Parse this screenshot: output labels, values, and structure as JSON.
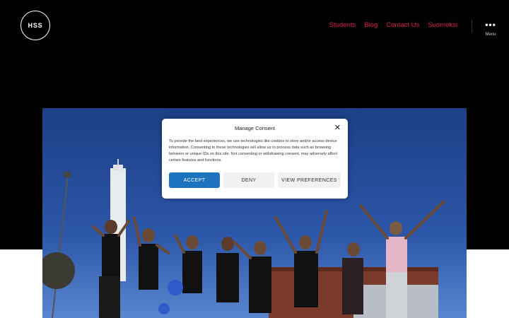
{
  "header": {
    "logo_text": "HSS",
    "nav": [
      "Students",
      "Blog",
      "Contact Us",
      "Suomeksi"
    ],
    "menu_label": "Menu",
    "menu_icon": "more-dots-icon"
  },
  "consent": {
    "title": "Manage Consent",
    "body": "To provide the best experiences, we use technologies like cookies to store and/or access device information. Consenting to these technologies will allow us to process data such as browsing behavior or unique IDs on this site. Not consenting or withdrawing consent, may adversely affect certain features and functions.",
    "accept_label": "ACCEPT",
    "deny_label": "DENY",
    "preferences_label": "VIEW PREFERENCES",
    "close_icon": "close-icon"
  },
  "colors": {
    "nav_link": "#d6214f",
    "accept_button": "#1e73be",
    "header_bg": "#000000",
    "sky": "#2c56a8"
  }
}
